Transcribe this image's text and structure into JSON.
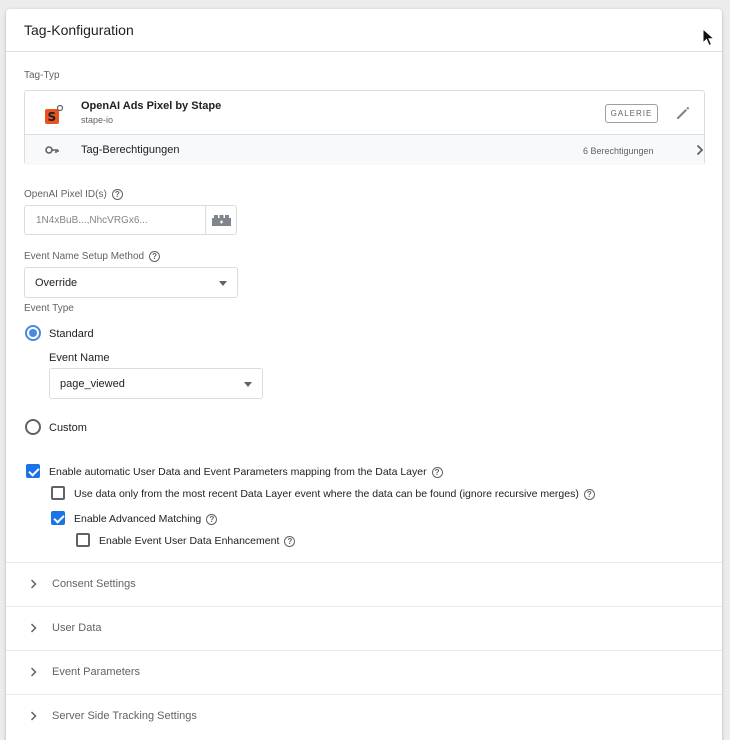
{
  "card": {
    "title": "Tag-Konfiguration"
  },
  "tag_type": {
    "section_label": "Tag-Typ",
    "name": "OpenAI Ads Pixel by Stape",
    "vendor": "stape-io",
    "gallery_button": "GALERIE",
    "permissions_label": "Tag-Berechtigungen",
    "permissions_count": "6 Berechtigungen"
  },
  "pixel_ids": {
    "label": "OpenAI Pixel ID(s)",
    "value": "1N4xBuB...,NhcVRGx6..."
  },
  "event_name_setup": {
    "label": "Event Name Setup Method",
    "selected": "Override"
  },
  "event_type": {
    "label": "Event Type",
    "options": [
      {
        "label": "Standard",
        "checked": true
      },
      {
        "label": "Custom",
        "checked": false
      }
    ],
    "event_name_label": "Event Name",
    "event_name_selected": "page_viewed"
  },
  "checkboxes": [
    {
      "label": "Enable automatic User Data and Event Parameters mapping from the Data Layer",
      "checked": true
    },
    {
      "label": "Use data only from the most recent Data Layer event where the data can be found (ignore recursive merges)",
      "checked": false
    },
    {
      "label": "Enable Advanced Matching",
      "checked": true
    },
    {
      "label": "Enable Event User Data Enhancement",
      "checked": false
    }
  ],
  "sections": [
    {
      "label": "Consent Settings"
    },
    {
      "label": "User Data"
    },
    {
      "label": "Event Parameters"
    },
    {
      "label": "Server Side Tracking Settings"
    }
  ],
  "help_glyph": "?",
  "colors": {
    "accent": "#1a73e8",
    "radio": "#4a89e0",
    "logo_orange": "#e8541e"
  }
}
